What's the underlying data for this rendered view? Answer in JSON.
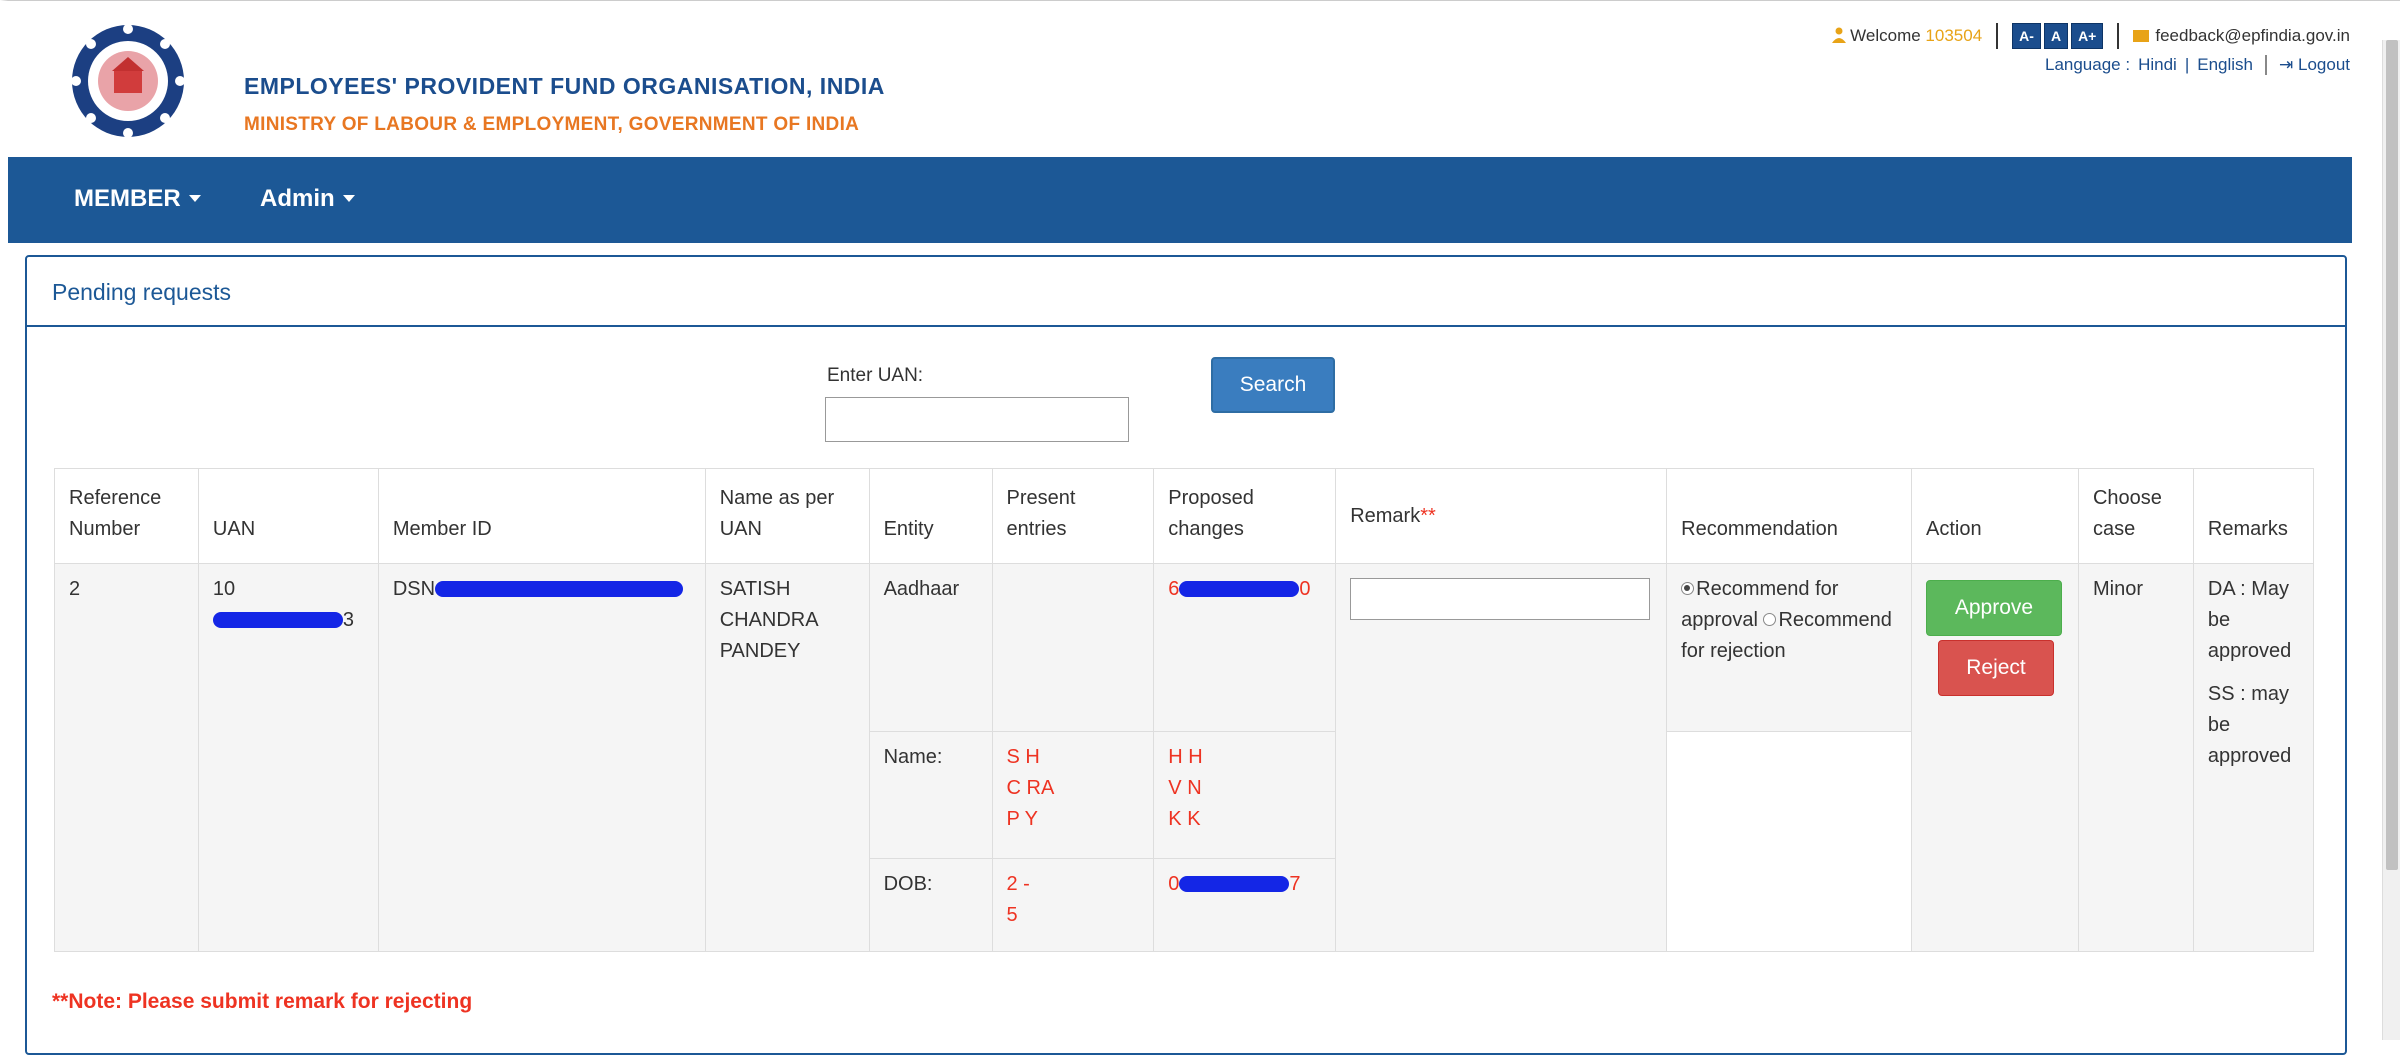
{
  "header": {
    "org_title": "EMPLOYEES' PROVIDENT FUND ORGANISATION, INDIA",
    "org_subtitle": "MINISTRY OF LABOUR & EMPLOYMENT, GOVERNMENT OF INDIA",
    "welcome_label": "Welcome",
    "welcome_id": "103504",
    "font_buttons": [
      "A-",
      "A",
      "A+"
    ],
    "feedback_email": "feedback@epfindia.gov.in",
    "language_label": "Language :",
    "lang_hindi": "Hindi",
    "lang_sep": "|",
    "lang_english": "English",
    "logout": "Logout"
  },
  "nav": {
    "items": [
      {
        "label": "MEMBER"
      },
      {
        "label": "Admin"
      }
    ]
  },
  "panel": {
    "title": "Pending requests",
    "uan_label": "Enter UAN:",
    "uan_value": "",
    "search_label": "Search"
  },
  "table": {
    "headers": [
      "Reference Number",
      "UAN",
      "Member ID",
      "Name as per UAN",
      "Entity",
      "Present entries",
      "Proposed changes",
      "Remark",
      "Recommendation",
      "Action",
      "Choose case",
      "Remarks"
    ],
    "remark_required_mark": "**",
    "row": {
      "ref": "2",
      "uan_prefix": "10",
      "uan_suffix": "3",
      "member_prefix": "DSN",
      "member_suffix": "",
      "name": "SATISH CHANDRA PANDEY",
      "entities": [
        {
          "entity": "Aadhaar",
          "present": "",
          "proposed_prefix": "6",
          "proposed_suffix": "0"
        },
        {
          "entity": "Name:",
          "present_lines": [
            "S   H",
            "C    RA",
            "P    Y"
          ],
          "proposed_lines": [
            "H     H",
            "V      N",
            "K     K"
          ]
        },
        {
          "entity": "DOB:",
          "present_lines": [
            "2     -",
            "   5"
          ],
          "proposed_prefix": "0",
          "proposed_suffix": "7"
        }
      ],
      "recommend_approval": "Recommend for approval",
      "recommend_rejection": "Recommend for rejection",
      "approve_label": "Approve",
      "reject_label": "Reject",
      "case": "Minor",
      "remarks_lines": [
        "DA : May be approved",
        "SS : may be approved"
      ]
    }
  },
  "note": "**Note: Please submit remark for rejecting",
  "colors": {
    "primary": "#1c5896",
    "accent": "#e87722",
    "approve": "#5cb85c",
    "reject": "#d9534f",
    "required": "#e32"
  }
}
